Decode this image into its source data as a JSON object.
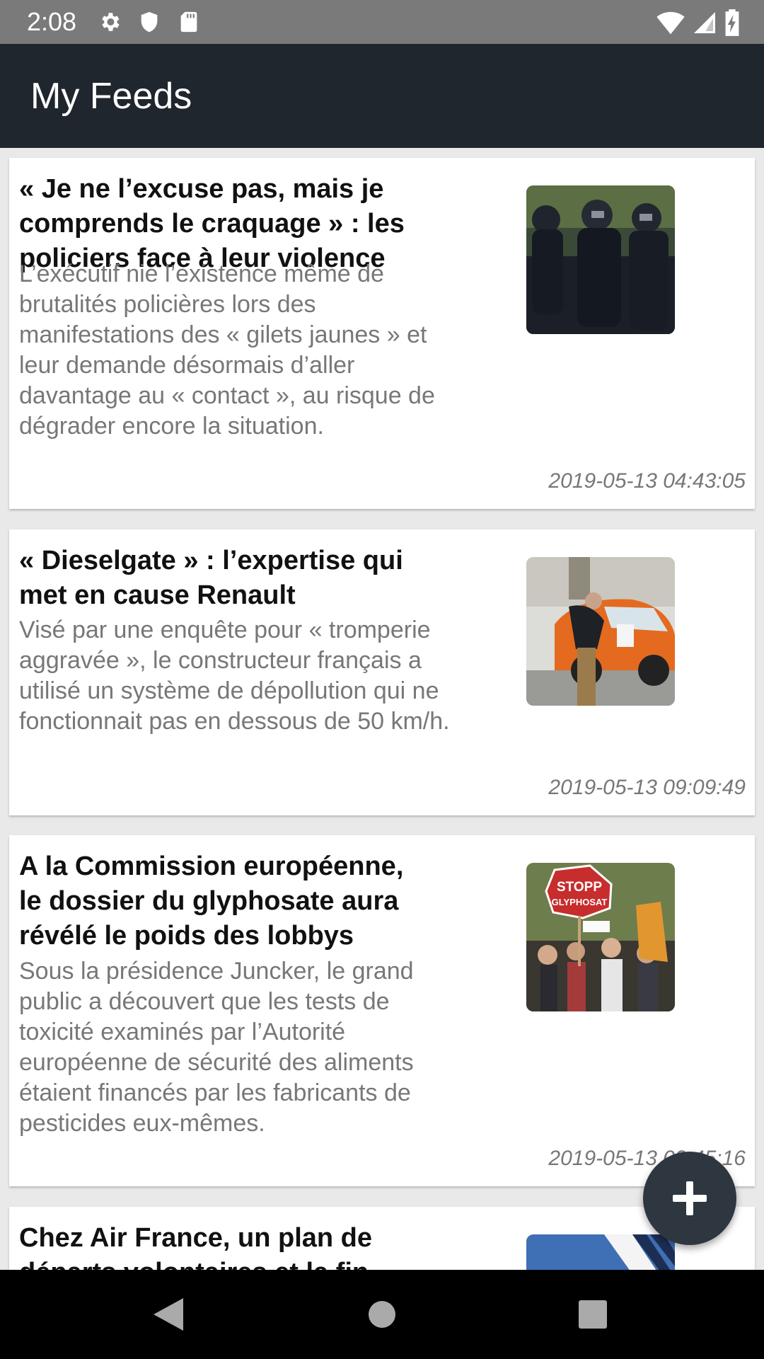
{
  "status_bar": {
    "time": "2:08",
    "left_icons": [
      "gear-icon",
      "shield-icon",
      "sd-card-icon"
    ],
    "right_icons": [
      "wifi-icon",
      "signal-icon",
      "battery-icon"
    ]
  },
  "app_bar": {
    "title": "My Feeds",
    "background": "#1f262d"
  },
  "feeds": [
    {
      "title": "« Je ne l’excuse pas, mais je comprends le craquage » : les policiers face à leur violence",
      "description": "L’exécutif nie l’existence même de brutalités policières lors des manifestations des « gilets jaunes » et leur demande désormais d’aller davantage au « contact », au risque de dégrader encore la situation.",
      "date": "2019-05-13 04:43:05",
      "thumbnail": "riot-police-photo"
    },
    {
      "title": "« Dieselgate » : l’expertise qui met en cause Renault",
      "description": "Visé par une enquête pour « tromperie aggravée », le construc­teur français a utilisé un système de dépollution qui ne fonctionnait pas en dessous de 50 km/h.",
      "date": "2019-05-13 09:09:49",
      "thumbnail": "car-show-photo"
    },
    {
      "title": "A la Commission européenne, le dossier du glyphosate aura révélé le poids des lobbys",
      "description": "Sous la présidence Juncker, le grand public a découvert que les tests de toxicité examinés par l’Autorité européenne de sécurité des aliments étaient financés par les fabricants de pesticides eux-mêmes.",
      "date": "2019-05-13 09:45:16",
      "thumbnail": "protest-photo",
      "sign_text": [
        "STOPP",
        "GLYPHOSAT"
      ]
    },
    {
      "title": "Chez Air France, un plan de départs volontaires et la fin",
      "thumbnail": "air-france-photo"
    }
  ],
  "fab": {
    "label": "+",
    "icon": "add-icon",
    "color": "#2e3640"
  },
  "nav_bar": {
    "buttons": [
      "back-icon",
      "home-icon",
      "recents-icon"
    ]
  }
}
